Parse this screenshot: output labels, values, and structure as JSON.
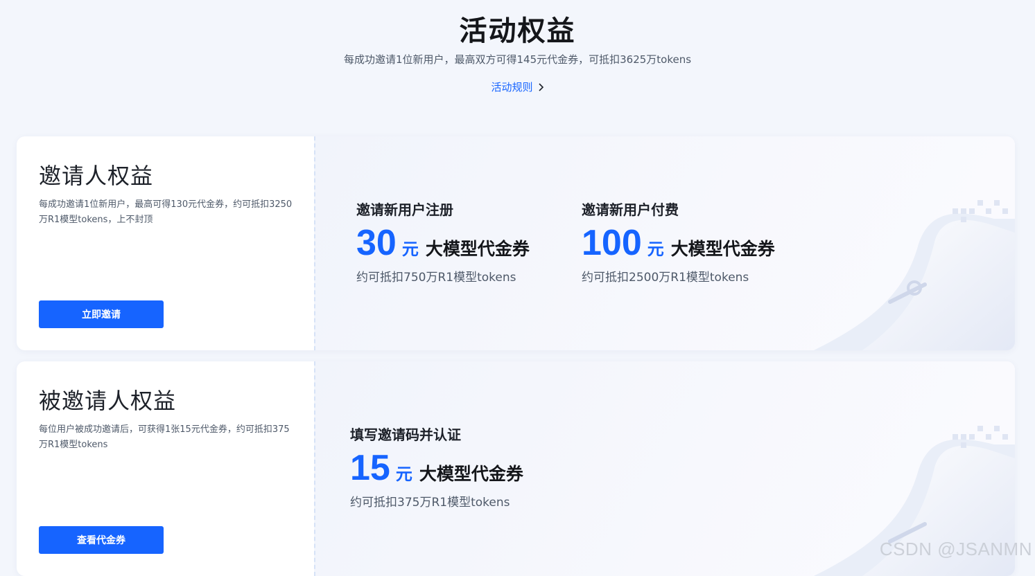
{
  "header": {
    "title": "活动权益",
    "subtitle": "每成功邀请1位新用户，最高双方可得145元代金券，可抵扣3625万tokens",
    "rules_link": "活动规则"
  },
  "inviter": {
    "title": "邀请人权益",
    "description": "每成功邀请1位新用户，最高可得130元代金券，约可抵扣3250万R1模型tokens，上不封顶",
    "button": "立即邀请",
    "benefits": [
      {
        "label": "邀请新用户注册",
        "amount": "30",
        "unit": "元",
        "type": "大模型代金券",
        "note": "约可抵扣750万R1模型tokens"
      },
      {
        "label": "邀请新用户付费",
        "amount": "100",
        "unit": "元",
        "type": "大模型代金券",
        "note": "约可抵扣2500万R1模型tokens"
      }
    ]
  },
  "invitee": {
    "title": "被邀请人权益",
    "description": "每位用户被成功邀请后，可获得1张15元代金券，约可抵扣375万R1模型tokens",
    "button": "查看代金券",
    "benefits": [
      {
        "label": "填写邀请码并认证",
        "amount": "15",
        "unit": "元",
        "type": "大模型代金券",
        "note": "约可抵扣375万R1模型tokens"
      }
    ]
  },
  "watermark": "CSDN @JSANMN",
  "colors": {
    "accent": "#1664ff",
    "page_background": "#f3f6fc",
    "card_background": "#ffffff"
  },
  "icons": [
    "chevron-right-icon",
    "coupon-decoration"
  ]
}
